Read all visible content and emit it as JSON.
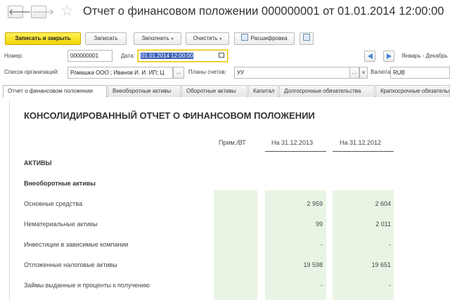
{
  "window": {
    "title": "Отчет о финансовом положении 000000001 от 01.01.2014 12:00:00",
    "back_glyph": "🡐",
    "forward_glyph": "🡒",
    "star_glyph": "☆"
  },
  "toolbar": {
    "save_close": "Записать и закрыть",
    "save": "Записать",
    "fill": "Заполнить",
    "clear": "Очистить",
    "breakdown": "Расшифровка",
    "caret": "▾"
  },
  "form": {
    "number_label": "Номер:",
    "number_value": "000000001",
    "date_label": "Дата:",
    "date_value": "01.01.2014 12:00:00",
    "period_text": "Январь - Декабрь",
    "orgs_label": "Список организаций:",
    "orgs_value": "Ромашка ООО ; Иванов И. И. ИП; Ц",
    "ellipsis": "...",
    "close_x": "×",
    "accounts_label": "Планы счетов:",
    "accounts_value": "УУ",
    "currency_label": "Валюта:",
    "currency_value": "RUB"
  },
  "tabs": [
    {
      "label": "Отчет о финансовом положении"
    },
    {
      "label": "Внеоборотные активы"
    },
    {
      "label": "Оборотные активы"
    },
    {
      "label": "Капитал"
    },
    {
      "label": "Долгосрочные обязательства"
    },
    {
      "label": "Краткосрочные обязательства"
    }
  ],
  "report": {
    "title": "КОНСОЛИДИРОВАННЫЙ ОТЧЕТ О ФИНАНСОВОМ ПОЛОЖЕНИИ",
    "columns": [
      "Прим./ВТ",
      "На 31.12.2013",
      "На 31.12.2012"
    ],
    "section": "АКТИВЫ",
    "subsection": "Внеоборотные активы",
    "rows": [
      {
        "label": "Основные средства",
        "v2013": "2 959",
        "v2012": "2 604"
      },
      {
        "label": "Нематериальные активы",
        "v2013": "99",
        "v2012": "2 011"
      },
      {
        "label": "Инвестиции в зависимые компании",
        "v2013": "-",
        "v2012": "-"
      },
      {
        "label": "Отложенные налоговые активы",
        "v2013": "19 598",
        "v2012": "19 651"
      },
      {
        "label": "Займы выданные и проценты к получению",
        "v2013": "-",
        "v2012": "-"
      }
    ]
  },
  "colors": {
    "accent_yellow": "#f0d600",
    "highlight_green": "#e9f5e4",
    "selection_blue": "#3c62b9"
  }
}
